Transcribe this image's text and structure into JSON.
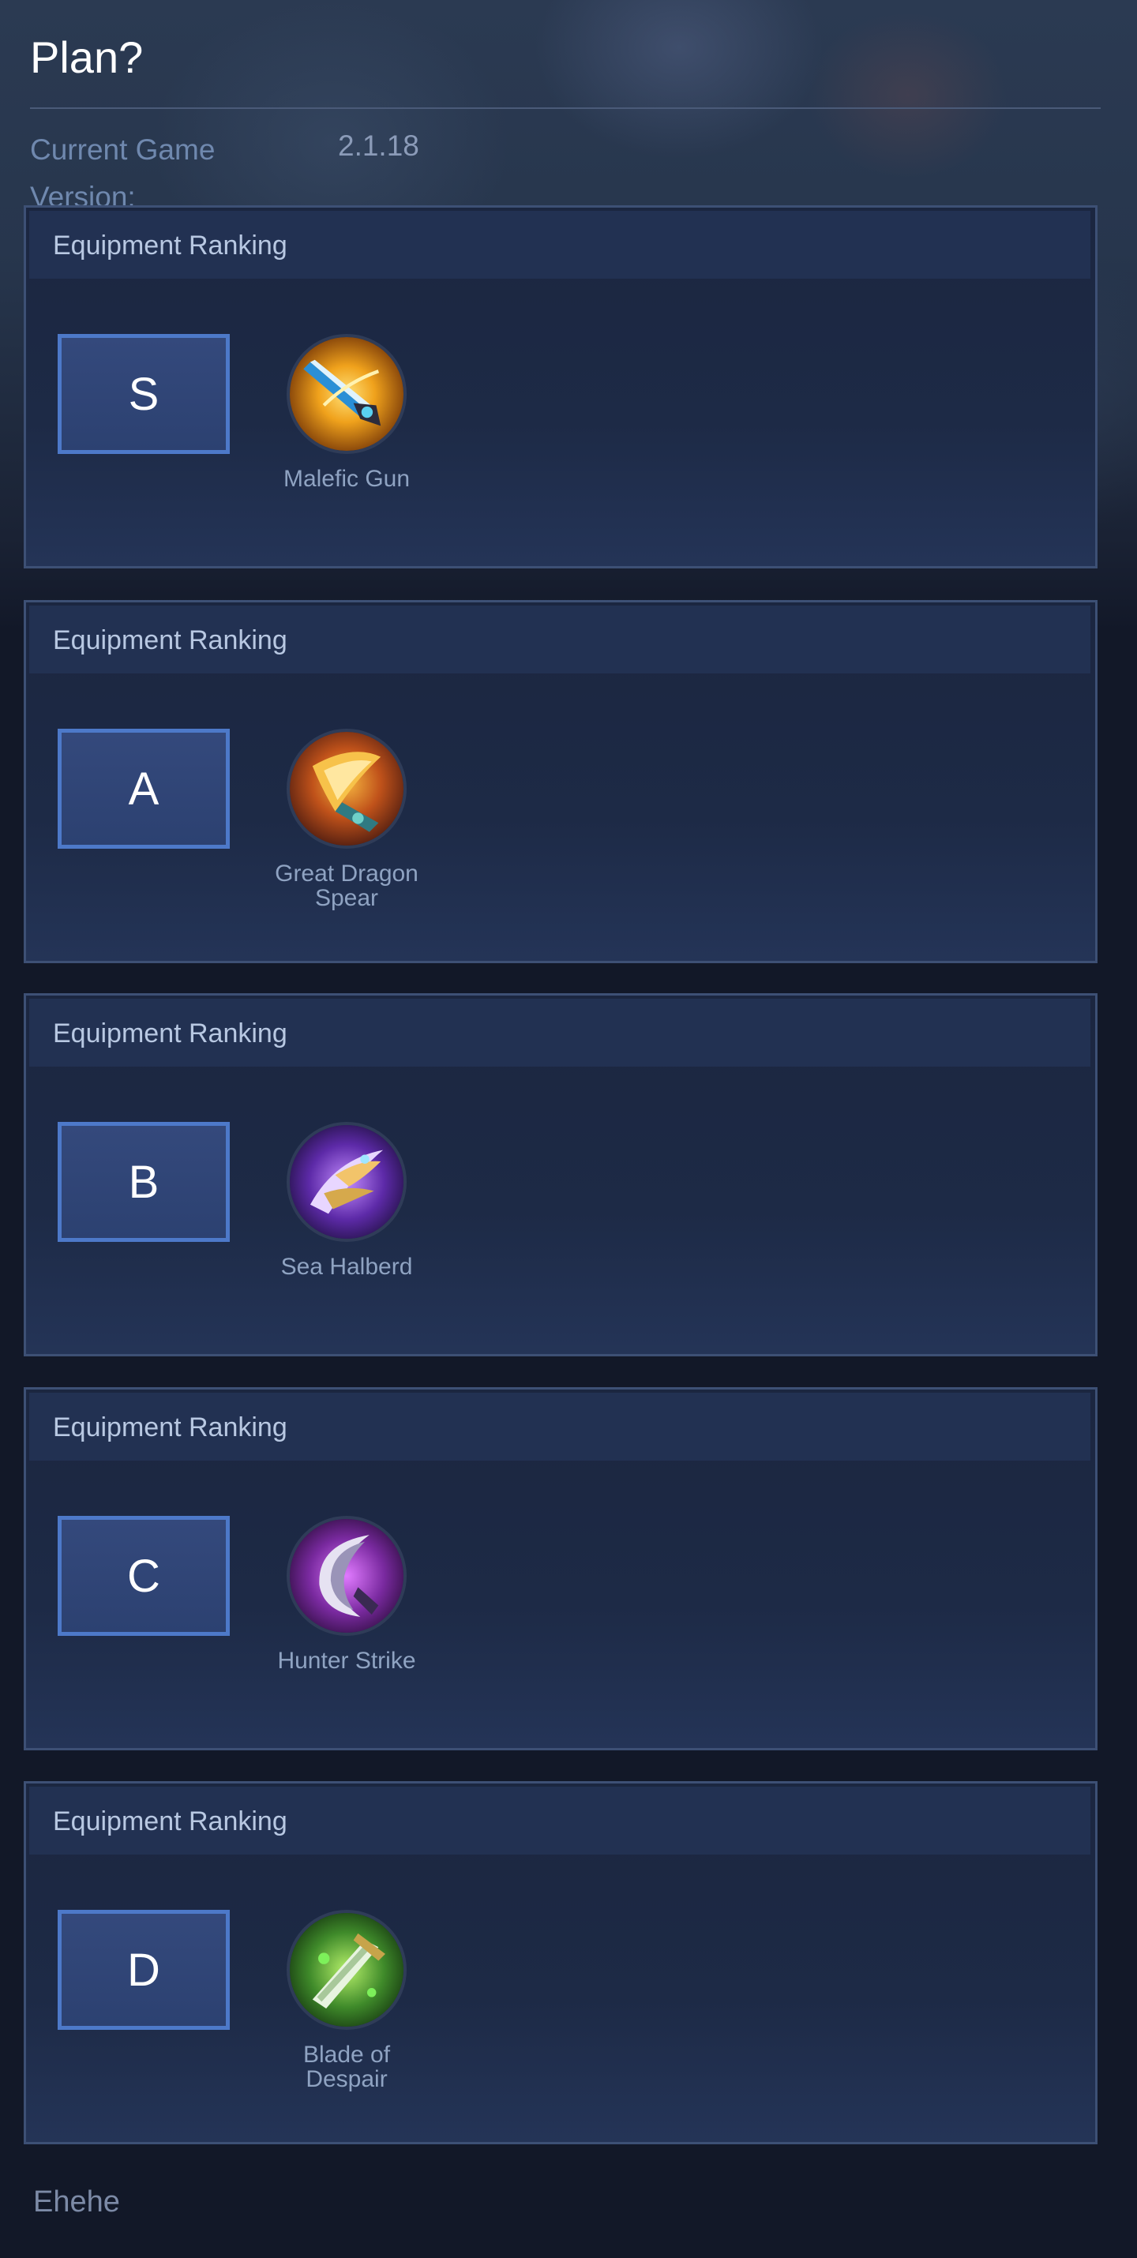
{
  "page": {
    "title": "Plan?"
  },
  "version": {
    "label": "Current Game Version:",
    "value": "2.1.18"
  },
  "rankings": [
    {
      "header": "Equipment Ranking",
      "tier": "S",
      "item_name": "Malefic Gun",
      "icon": "malefic-gun-icon"
    },
    {
      "header": "Equipment Ranking",
      "tier": "A",
      "item_name": "Great Dragon Spear",
      "icon": "great-dragon-spear-icon"
    },
    {
      "header": "Equipment Ranking",
      "tier": "B",
      "item_name": "Sea Halberd",
      "icon": "sea-halberd-icon"
    },
    {
      "header": "Equipment Ranking",
      "tier": "C",
      "item_name": "Hunter Strike",
      "icon": "hunter-strike-icon"
    },
    {
      "header": "Equipment Ranking",
      "tier": "D",
      "item_name": "Blade of Despair",
      "icon": "blade-of-despair-icon"
    }
  ],
  "footer": {
    "text": "Ehehe"
  },
  "colors": {
    "background": "#121828",
    "card_bg": "#1d2a46",
    "card_border": "#3d5075",
    "tier_border": "#4d79c9",
    "muted_text": "#6f88ae"
  }
}
